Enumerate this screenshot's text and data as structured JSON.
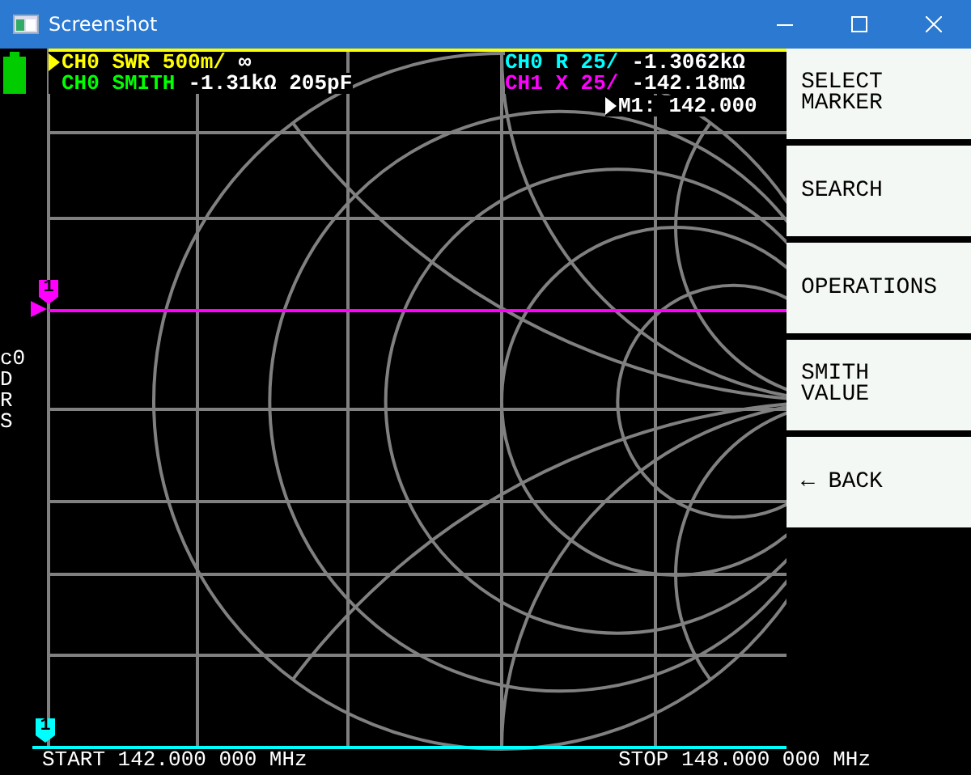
{
  "window": {
    "title": "Screenshot"
  },
  "traces": [
    {
      "label": "CH0 SWR 500m/",
      "value": "∞",
      "color": "#ffff00",
      "active": true
    },
    {
      "label": "CH0 SMITH",
      "value": "-1.31kΩ 205pF",
      "color": "#00ff00",
      "active": false
    },
    {
      "label": "CH0 R 25/",
      "value": "-1.3062kΩ",
      "color": "#00ffff",
      "active": false
    },
    {
      "label": "CH1 X 25/",
      "value": "-142.18mΩ",
      "color": "#ff00ff",
      "active": false
    }
  ],
  "marker_readout": "M1: 142.000",
  "side_labels": [
    "c0",
    "D",
    "R",
    "S"
  ],
  "markers": [
    {
      "label": "1",
      "color": "#ff00ff",
      "kind": "reference"
    },
    {
      "label": "1",
      "color": "#00ffff",
      "kind": "frequency"
    }
  ],
  "menu": [
    {
      "label": "SELECT\nMARKER"
    },
    {
      "label": "SEARCH"
    },
    {
      "label": "OPERATIONS"
    },
    {
      "label": "SMITH\nVALUE"
    },
    {
      "label": "← BACK"
    }
  ],
  "sweep": {
    "start": "START 142.000 000 MHz",
    "stop": "STOP 148.000 000 MHz"
  }
}
